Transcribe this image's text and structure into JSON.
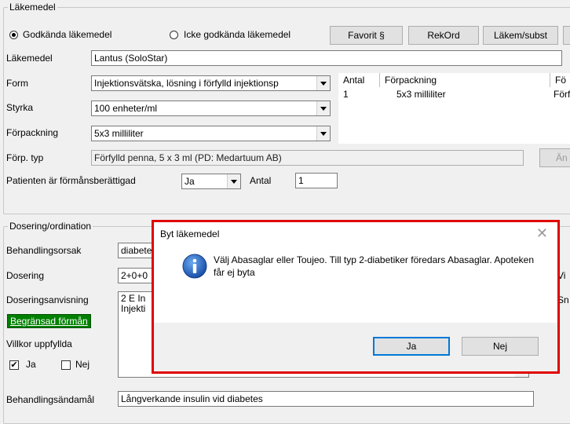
{
  "medicine_group": {
    "title": "Läkemedel",
    "radio_approved": "Godkända läkemedel",
    "radio_not_approved": "Icke godkända läkemedel",
    "buttons": [
      "Favorit §",
      "RekOrd",
      "Läkem/subst"
    ],
    "labels": {
      "medicine": "Läkemedel",
      "form": "Form",
      "strength": "Styrka",
      "package": "Förpackning",
      "package_type": "Förp. typ",
      "benefit": "Patienten är förmånsberättigad",
      "quantity": "Antal"
    },
    "values": {
      "medicine": "Lantus (SoloStar)",
      "form": "Injektionsvätska, lösning i förfylld injektionsp",
      "strength": "100 enheter/ml",
      "package": "5x3 milliliter",
      "package_type": "Förfylld penna, 5 x 3 ml (PD: Medartuum AB)",
      "benefit": "Ja",
      "quantity": "1"
    },
    "side_button_partial": "Än",
    "package_list": {
      "headers": [
        "Antal",
        "Förpackning",
        "Fö"
      ],
      "rows": [
        [
          "1",
          "5x3 milliliter",
          "Förf"
        ]
      ]
    }
  },
  "dosage_group": {
    "title": "Dosering/ordination",
    "labels": {
      "reason": "Behandlingsorsak",
      "dosage": "Dosering",
      "instructions": "Doseringsanvisning",
      "restricted_benefit": "Begränsad förmån",
      "conditions": "Villkor uppfyllda",
      "yes": "Ja",
      "no": "Nej",
      "purpose": "Behandlingsändamål"
    },
    "values": {
      "reason": "diabete",
      "dosage": "2+0+0",
      "instructions_line1": "2 E In",
      "instructions_line2": "Injekti",
      "purpose": "Långverkande insulin vid diabetes"
    },
    "right_labels": [
      "Vi",
      "Sn"
    ]
  },
  "dialog": {
    "title": "Byt läkemedel",
    "message": "Välj Abasaglar eller Toujeo. Till typ 2-diabetiker föredars Abasaglar. Apoteken får ej byta",
    "yes_button": "Ja",
    "no_button": "Nej",
    "close_symbol": "✕"
  },
  "colors": {
    "highlight_border": "#e00000",
    "restricted_benefit_bg": "#008000",
    "info_icon": "#1a64c8"
  }
}
